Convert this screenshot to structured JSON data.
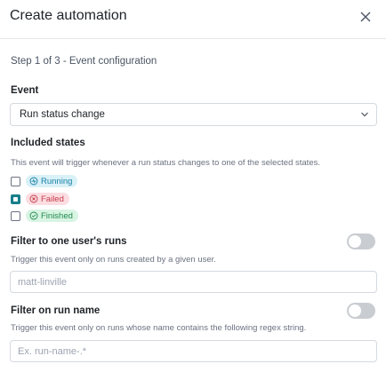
{
  "modal": {
    "title": "Create automation",
    "step": "Step 1 of 3 - Event configuration"
  },
  "event": {
    "label": "Event",
    "selected": "Run status change"
  },
  "included_states": {
    "label": "Included states",
    "help": "This event will trigger whenever a run status changes to one of the selected states.",
    "states": [
      {
        "label": "Running",
        "checked": false,
        "color": "#1a7fa8",
        "bg": "#d8f1f7"
      },
      {
        "label": "Failed",
        "checked": true,
        "color": "#c73a4b",
        "bg": "#fbdde1"
      },
      {
        "label": "Finished",
        "checked": false,
        "color": "#1f8a4d",
        "bg": "#d8f4e3"
      }
    ]
  },
  "user_filter": {
    "label": "Filter to one user's runs",
    "help": "Trigger this event only on runs created by a given user.",
    "value": "",
    "placeholder": "matt-linville",
    "enabled": false
  },
  "name_filter": {
    "label": "Filter on run name",
    "help": "Trigger this event only on runs whose name contains the following regex string.",
    "value": "",
    "placeholder": "Ex. run-name-.*",
    "enabled": false
  },
  "colors": {
    "accent": "#187e8a",
    "toggle_off": "#c9ccd1"
  }
}
